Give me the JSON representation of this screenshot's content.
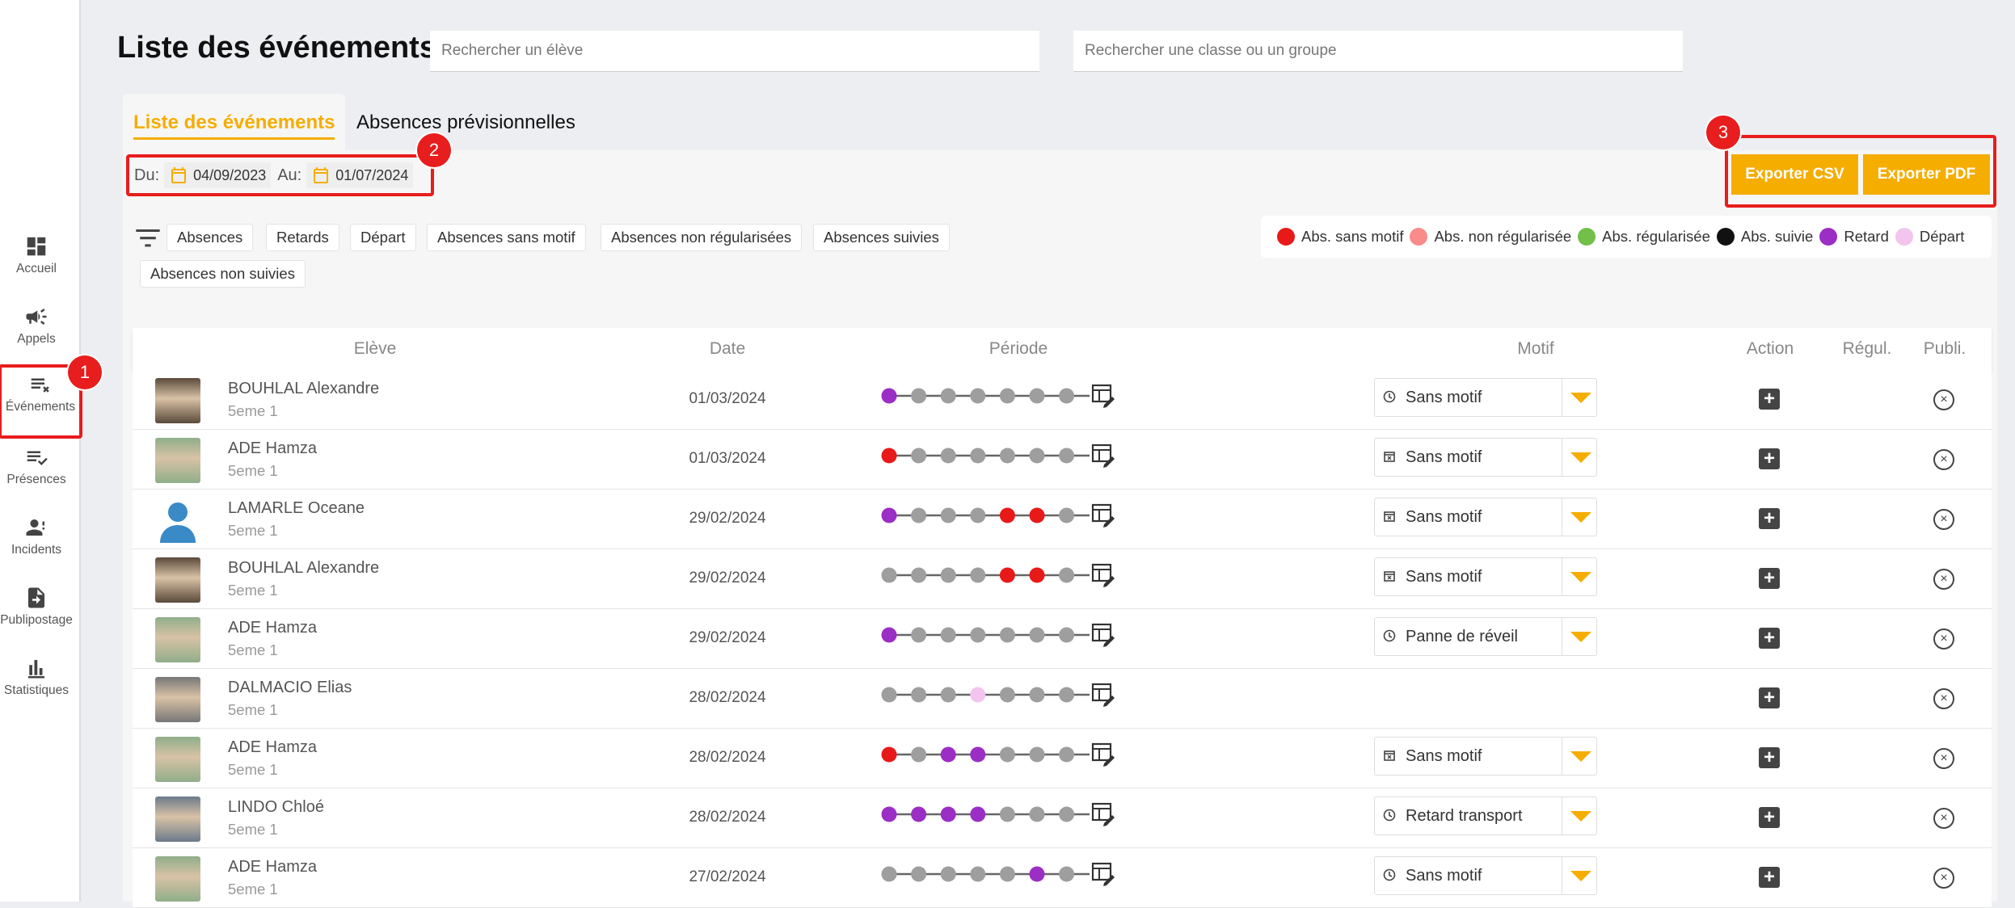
{
  "sidebar": {
    "items": [
      {
        "label": "Accueil",
        "icon": "dashboard-icon"
      },
      {
        "label": "Appels",
        "icon": "megaphone-icon"
      },
      {
        "label": "Événements",
        "icon": "list-remove-icon"
      },
      {
        "label": "Présences",
        "icon": "list-check-icon"
      },
      {
        "label": "Incidents",
        "icon": "person-alert-icon"
      },
      {
        "label": "Publipostage",
        "icon": "file-export-icon"
      },
      {
        "label": "Statistiques",
        "icon": "bar-chart-icon"
      }
    ]
  },
  "badges": [
    "1",
    "2",
    "3"
  ],
  "header": {
    "title": "Liste des événements",
    "search_student_placeholder": "Rechercher un élève",
    "search_class_placeholder": "Rechercher une classe ou un groupe"
  },
  "tabs": [
    {
      "label": "Liste des événements",
      "active": true
    },
    {
      "label": "Absences prévisionnelles",
      "active": false
    }
  ],
  "dates": {
    "from_label": "Du:",
    "from_value": "04/09/2023",
    "to_label": "Au:",
    "to_value": "01/07/2024"
  },
  "export": {
    "csv_label": "Exporter CSV",
    "pdf_label": "Exporter PDF"
  },
  "filters": [
    "Absences",
    "Retards",
    "Départ",
    "Absences sans motif",
    "Absences non régularisées",
    "Absences suivies",
    "Absences non suivies"
  ],
  "legend": [
    {
      "label": "Abs. sans motif",
      "color": "#e81919"
    },
    {
      "label": "Abs. non régularisée",
      "color": "#f98b8b"
    },
    {
      "label": "Abs. régularisée",
      "color": "#72bf4a"
    },
    {
      "label": "Abs. suivie",
      "color": "#111111"
    },
    {
      "label": "Retard",
      "color": "#9b2ec4"
    },
    {
      "label": "Départ",
      "color": "#f2c4ee"
    }
  ],
  "table": {
    "headers": {
      "eleve": "Elève",
      "date": "Date",
      "periode": "Période",
      "motif": "Motif",
      "action": "Action",
      "regul": "Régul.",
      "publi": "Publi."
    },
    "rows": [
      {
        "name": "BOUHLAL Alexandre",
        "class": "5eme 1",
        "date": "01/03/2024",
        "periods": [
          "retard",
          "n",
          "n",
          "n",
          "n",
          "n",
          "n"
        ],
        "motif": "Sans motif",
        "motif_icon": "clock-icon"
      },
      {
        "name": "ADE Hamza",
        "class": "5eme 1",
        "date": "01/03/2024",
        "periods": [
          "sans",
          "n",
          "n",
          "n",
          "n",
          "n",
          "n"
        ],
        "motif": "Sans motif",
        "motif_icon": "calendar-x-icon"
      },
      {
        "name": "LAMARLE Oceane",
        "class": "5eme 1",
        "date": "29/02/2024",
        "periods": [
          "retard",
          "n",
          "n",
          "n",
          "sans",
          "sans",
          "n"
        ],
        "motif": "Sans motif",
        "motif_icon": "calendar-x-icon"
      },
      {
        "name": "BOUHLAL Alexandre",
        "class": "5eme 1",
        "date": "29/02/2024",
        "periods": [
          "n",
          "n",
          "n",
          "n",
          "sans",
          "sans",
          "n"
        ],
        "motif": "Sans motif",
        "motif_icon": "calendar-x-icon"
      },
      {
        "name": "ADE Hamza",
        "class": "5eme 1",
        "date": "29/02/2024",
        "periods": [
          "retard",
          "n",
          "n",
          "n",
          "n",
          "n",
          "n"
        ],
        "motif": "Panne de réveil",
        "motif_icon": "clock-icon"
      },
      {
        "name": "DALMACIO Elias",
        "class": "5eme 1",
        "date": "28/02/2024",
        "periods": [
          "n",
          "n",
          "n",
          "depart",
          "n",
          "n",
          "n"
        ],
        "motif": "",
        "motif_icon": ""
      },
      {
        "name": "ADE Hamza",
        "class": "5eme 1",
        "date": "28/02/2024",
        "periods": [
          "sans",
          "n",
          "retard",
          "retard",
          "n",
          "n",
          "n"
        ],
        "motif": "Sans motif",
        "motif_icon": "calendar-x-icon"
      },
      {
        "name": "LINDO Chloé",
        "class": "5eme 1",
        "date": "28/02/2024",
        "periods": [
          "retard",
          "retard",
          "retard",
          "retard",
          "n",
          "n",
          "n"
        ],
        "motif": "Retard transport",
        "motif_icon": "clock-icon"
      },
      {
        "name": "ADE Hamza",
        "class": "5eme 1",
        "date": "27/02/2024",
        "periods": [
          "n",
          "n",
          "n",
          "n",
          "n",
          "retard",
          "n"
        ],
        "motif": "Sans motif",
        "motif_icon": "clock-icon"
      }
    ]
  }
}
